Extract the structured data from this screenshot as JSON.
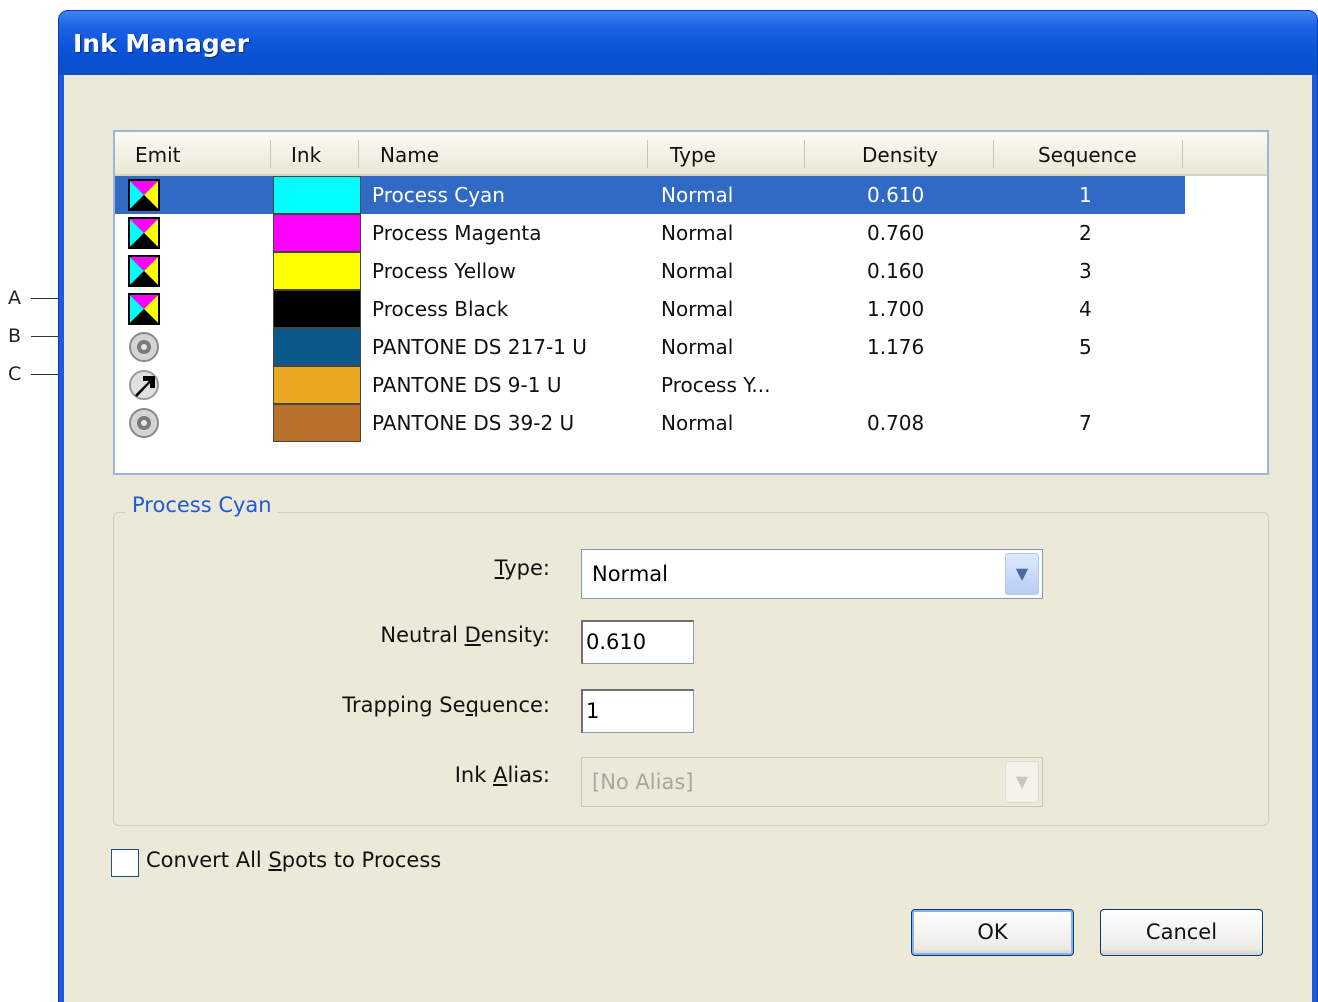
{
  "callouts": [
    "A",
    "B",
    "C"
  ],
  "window": {
    "title": "Ink Manager"
  },
  "table": {
    "headers": {
      "emit": "Emit",
      "ink": "Ink",
      "name": "Name",
      "type": "Type",
      "density": "Density",
      "sequence": "Sequence"
    },
    "rows": [
      {
        "emit": "process-ink-icon",
        "color": "#00ffff",
        "name": "Process Cyan",
        "type": "Normal",
        "density": "0.610",
        "sequence": "1",
        "selected": true
      },
      {
        "emit": "process-ink-icon",
        "color": "#ff00ff",
        "name": "Process Magenta",
        "type": "Normal",
        "density": "0.760",
        "sequence": "2"
      },
      {
        "emit": "process-ink-icon",
        "color": "#ffff00",
        "name": "Process Yellow",
        "type": "Normal",
        "density": "0.160",
        "sequence": "3"
      },
      {
        "emit": "process-ink-icon",
        "color": "#000000",
        "name": "Process Black",
        "type": "Normal",
        "density": "1.700",
        "sequence": "4"
      },
      {
        "emit": "spot-ink-icon",
        "color": "#0a578a",
        "name": "PANTONE DS 217-1 U",
        "type": "Normal",
        "density": "1.176",
        "sequence": "5"
      },
      {
        "emit": "alias-ink-icon",
        "color": "#e8a821",
        "name": "PANTONE DS 9-1 U",
        "type": "Process Y...",
        "density": "",
        "sequence": ""
      },
      {
        "emit": "spot-ink-icon",
        "color": "#b8702a",
        "name": "PANTONE DS 39-2 U",
        "type": "Normal",
        "density": "0.708",
        "sequence": "7"
      }
    ]
  },
  "details": {
    "group_title": "Process Cyan",
    "type_label_mnemonic": "T",
    "type_label_rest": "ype:",
    "type_value": "Normal",
    "density_label_pre": "Neutral ",
    "density_label_mnemonic": "D",
    "density_label_rest": "ensity:",
    "density_value": "0.610",
    "sequence_label": "Trapping Se",
    "sequence_label_mnemonic": "q",
    "sequence_label_rest": "uence:",
    "sequence_value": "1",
    "alias_label_pre": "Ink ",
    "alias_label_mnemonic": "A",
    "alias_label_rest": "lias:",
    "alias_value": "[No Alias]"
  },
  "convert_all": {
    "label_pre": "Convert All ",
    "label_mnemonic": "S",
    "label_rest": "pots to Process",
    "checked": false
  },
  "buttons": {
    "ok": "OK",
    "cancel": "Cancel"
  },
  "colors": {
    "titlebar": "#0a54d8",
    "selection": "#316ac5",
    "group_title": "#1f5ad8",
    "face": "#ece9d8"
  }
}
